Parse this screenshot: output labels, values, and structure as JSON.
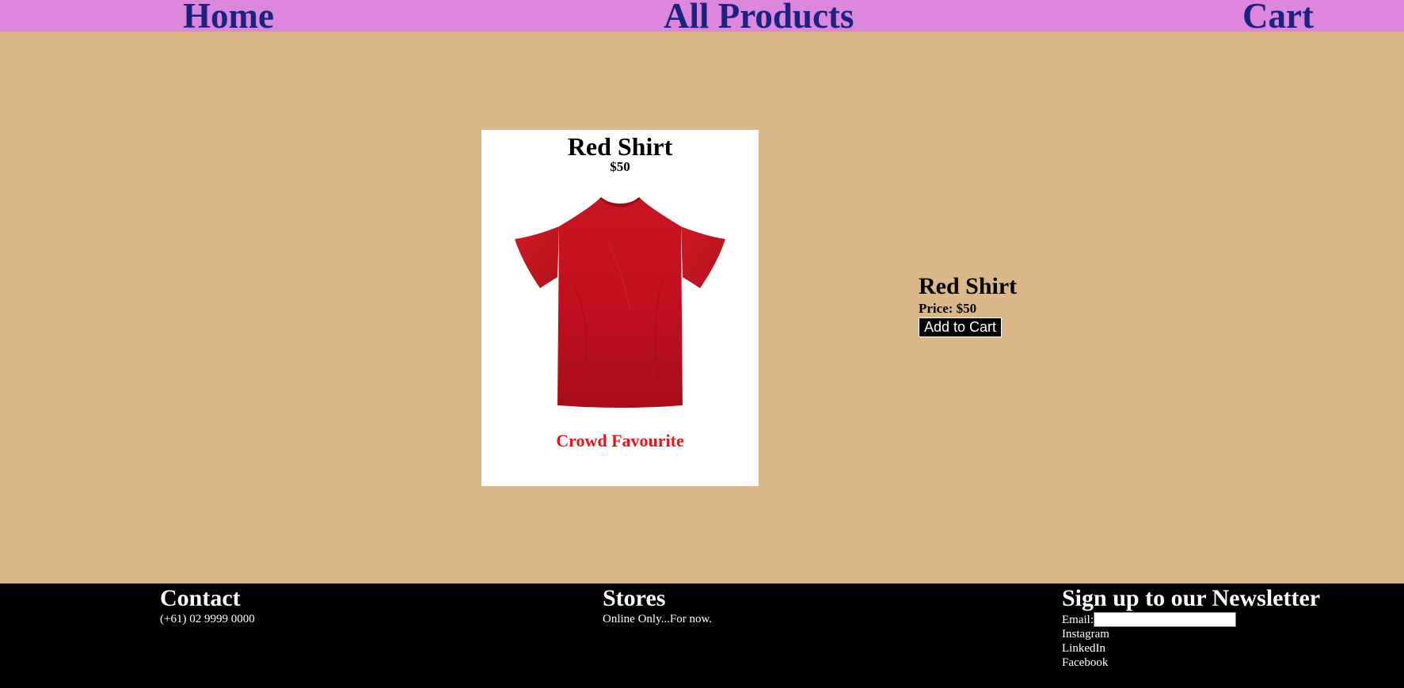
{
  "nav": {
    "home": "Home",
    "products": "All Products",
    "cart": "Cart"
  },
  "product_card": {
    "title": "Red Shirt",
    "price": "$50",
    "badge": "Crowd Favourite",
    "image": "red-tshirt"
  },
  "details": {
    "title": "Red Shirt",
    "price": "Price: $50",
    "add_button": "Add to Cart"
  },
  "footer": {
    "contact": {
      "heading": "Contact",
      "phone": "(+61) 02 9999 0000"
    },
    "stores": {
      "heading": "Stores",
      "text": "Online Only...For now."
    },
    "newsletter": {
      "heading": "Sign up to our Newsletter",
      "email_label": "Email:",
      "email_value": "",
      "links": [
        "Instagram",
        "LinkedIn",
        "Facebook"
      ]
    }
  },
  "colors": {
    "nav_bg": "#dc87dc",
    "nav_text": "#1b237f",
    "page_bg": "#dbb789",
    "badge": "#e8141b",
    "footer_bg": "#000000"
  }
}
